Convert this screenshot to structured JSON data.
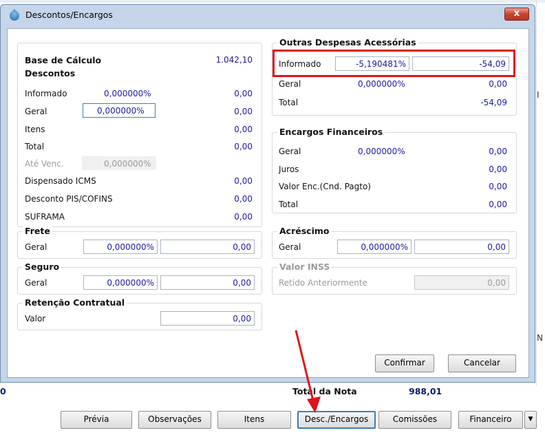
{
  "window": {
    "title": "Descontos/Encargos",
    "close_label": "x"
  },
  "base_calculo": {
    "label": "Base de Cálculo",
    "value": "1.042,10"
  },
  "descontos": {
    "title": "Descontos",
    "rows": [
      {
        "label": "Informado",
        "pct": "0,000000%",
        "value": "0,00"
      },
      {
        "label": "Geral",
        "pct": "0,000000%",
        "value": "0,00"
      },
      {
        "label": "Itens",
        "value": "0,00"
      },
      {
        "label": "Total",
        "value": "0,00"
      },
      {
        "label": "Até Venc.",
        "pct": "0,000000%"
      },
      {
        "label": "Dispensado ICMS",
        "value": "0,00"
      },
      {
        "label": "Desconto PIS/COFINS",
        "value": "0,00"
      },
      {
        "label": "SUFRAMA",
        "value": "0,00"
      }
    ]
  },
  "frete": {
    "title": "Frete",
    "label": "Geral",
    "pct": "0,000000%",
    "value": "0,00"
  },
  "seguro": {
    "title": "Seguro",
    "label": "Geral",
    "pct": "0,000000%",
    "value": "0,00"
  },
  "retencao": {
    "title": "Retenção Contratual",
    "label": "Valor",
    "value": "0,00"
  },
  "outras_despesas": {
    "title": "Outras Despesas Acessórias",
    "informado": {
      "label": "Informado",
      "pct": "-5,190481%",
      "value": "-54,09"
    },
    "geral": {
      "label": "Geral",
      "pct": "0,000000%",
      "value": "0,00"
    },
    "total": {
      "label": "Total",
      "value": "-54,09"
    }
  },
  "encargos": {
    "title": "Encargos Financeiros",
    "geral": {
      "label": "Geral",
      "pct": "0,000000%",
      "value": "0,00"
    },
    "juros": {
      "label": "Juros",
      "value": "0,00"
    },
    "valor_enc": {
      "label": "Valor Enc.(Cnd. Pagto)",
      "value": "0,00"
    },
    "total": {
      "label": "Total",
      "value": "0,00"
    }
  },
  "acrescimo": {
    "title": "Acréscimo",
    "label": "Geral",
    "pct": "0,000000%",
    "value": "0,00"
  },
  "valor_inss": {
    "title": "Valor INSS",
    "label": "Retido Anteriormente",
    "value": "0,00"
  },
  "dialog_buttons": {
    "confirmar": "Confirmar",
    "cancelar": "Cancelar"
  },
  "footer": {
    "left_value": "0",
    "total_label": "Total da Nota",
    "total_value": "988,01",
    "buttons": [
      "Prévia",
      "Observações",
      "Itens",
      "Desc./Encargos",
      "Comissões",
      "Financeiro"
    ],
    "dropdown_icon": "caret-down",
    "edge_chars": [
      "I",
      "N"
    ]
  },
  "colors": {
    "value_blue": "#1a1a9e",
    "highlight_red": "#e0141b",
    "title_bg": "#c5d6ea"
  }
}
